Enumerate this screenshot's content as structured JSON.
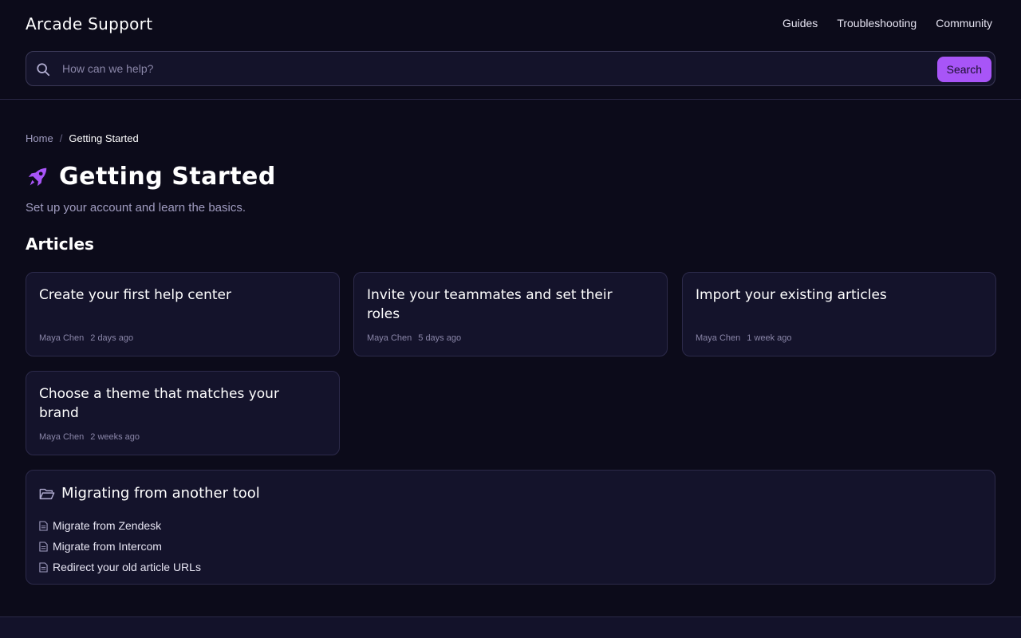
{
  "header": {
    "brand": "Arcade Support",
    "nav": [
      "Guides",
      "Troubleshooting",
      "Community"
    ],
    "search": {
      "placeholder": "How can we help?",
      "button_label": "Search"
    }
  },
  "breadcrumb": {
    "home": "Home",
    "separator": "/",
    "current": "Getting Started"
  },
  "page": {
    "icon": "rocket-icon",
    "title": "Getting Started",
    "subtitle": "Set up your account and learn the basics."
  },
  "articles": {
    "heading": "Articles",
    "items": [
      {
        "title": "Create your first help center",
        "author": "Maya Chen",
        "time": "2 days ago"
      },
      {
        "title": "Invite your teammates and set their roles",
        "author": "Maya Chen",
        "time": "5 days ago"
      },
      {
        "title": "Import your existing articles",
        "author": "Maya Chen",
        "time": "1 week ago"
      },
      {
        "title": "Choose a theme that matches your brand",
        "author": "Maya Chen",
        "time": "2 weeks ago"
      }
    ]
  },
  "folder": {
    "icon": "folder-open-icon",
    "title": "Migrating from another tool",
    "items": [
      "Migrate from Zendesk",
      "Migrate from Intercom",
      "Redirect your old article URLs"
    ]
  },
  "colors": {
    "background": "#0c0b1a",
    "card": "#14132b",
    "accent": "#a855f7",
    "muted": "#a09cc0"
  }
}
